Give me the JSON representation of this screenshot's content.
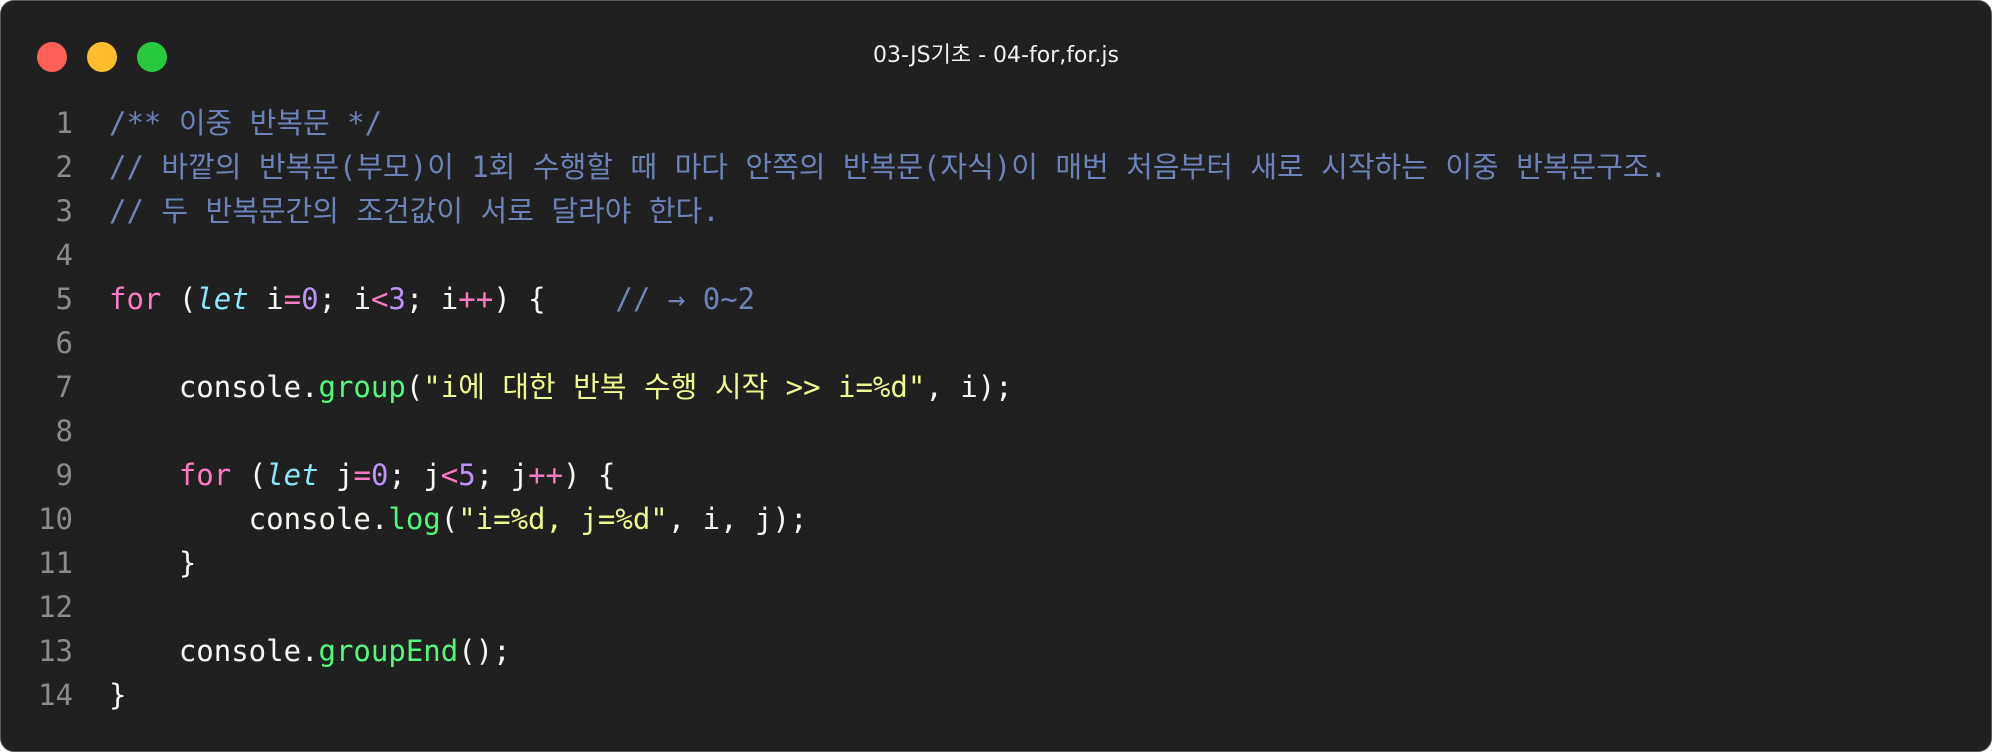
{
  "window": {
    "title": "03-JS기초 - 04-for,for.js"
  },
  "colors": {
    "background": "#202020",
    "close": "#ff5f56",
    "minimize": "#ffbd2e",
    "maximize": "#27c93f",
    "comment": "#6c83b9",
    "keyword": "#ff79c6",
    "let": "#8be9fd",
    "number": "#bd93f9",
    "function": "#50fa7b",
    "string": "#f1fa8c",
    "line_number": "#8b8b8b"
  },
  "code": {
    "lines": [
      {
        "number": "1",
        "tokens": [
          {
            "type": "comment",
            "text": "/** 이중 반복문 */"
          }
        ]
      },
      {
        "number": "2",
        "tokens": [
          {
            "type": "comment",
            "text": "// 바깥의 반복문(부모)이 1회 수행할 때 마다 안쪽의 반복문(자식)이 매번 처음부터 새로 시작하는 이중 반복문구조."
          }
        ]
      },
      {
        "number": "3",
        "tokens": [
          {
            "type": "comment",
            "text": "// 두 반복문간의 조건값이 서로 달라야 한다."
          }
        ]
      },
      {
        "number": "4",
        "tokens": []
      },
      {
        "number": "5",
        "tokens": [
          {
            "type": "keyword",
            "text": "for"
          },
          {
            "type": "plain",
            "text": " ("
          },
          {
            "type": "let",
            "text": "let"
          },
          {
            "type": "plain",
            "text": " i"
          },
          {
            "type": "op",
            "text": "="
          },
          {
            "type": "number",
            "text": "0"
          },
          {
            "type": "plain",
            "text": "; i"
          },
          {
            "type": "op",
            "text": "<"
          },
          {
            "type": "number",
            "text": "3"
          },
          {
            "type": "plain",
            "text": "; i"
          },
          {
            "type": "op",
            "text": "++"
          },
          {
            "type": "plain",
            "text": ") {    "
          },
          {
            "type": "comment",
            "text": "// → 0~2"
          }
        ]
      },
      {
        "number": "6",
        "tokens": []
      },
      {
        "number": "7",
        "tokens": [
          {
            "type": "plain",
            "text": "    console."
          },
          {
            "type": "func",
            "text": "group"
          },
          {
            "type": "plain",
            "text": "("
          },
          {
            "type": "string",
            "text": "\"i에 대한 반복 수행 시작 >> i=%d\""
          },
          {
            "type": "plain",
            "text": ", i);"
          }
        ]
      },
      {
        "number": "8",
        "tokens": []
      },
      {
        "number": "9",
        "tokens": [
          {
            "type": "plain",
            "text": "    "
          },
          {
            "type": "keyword",
            "text": "for"
          },
          {
            "type": "plain",
            "text": " ("
          },
          {
            "type": "let",
            "text": "let"
          },
          {
            "type": "plain",
            "text": " j"
          },
          {
            "type": "op",
            "text": "="
          },
          {
            "type": "number",
            "text": "0"
          },
          {
            "type": "plain",
            "text": "; j"
          },
          {
            "type": "op",
            "text": "<"
          },
          {
            "type": "number",
            "text": "5"
          },
          {
            "type": "plain",
            "text": "; j"
          },
          {
            "type": "op",
            "text": "++"
          },
          {
            "type": "plain",
            "text": ") {"
          }
        ]
      },
      {
        "number": "10",
        "tokens": [
          {
            "type": "plain",
            "text": "        console."
          },
          {
            "type": "func",
            "text": "log"
          },
          {
            "type": "plain",
            "text": "("
          },
          {
            "type": "string",
            "text": "\"i=%d, j=%d\""
          },
          {
            "type": "plain",
            "text": ", i, j);"
          }
        ]
      },
      {
        "number": "11",
        "tokens": [
          {
            "type": "plain",
            "text": "    }"
          }
        ]
      },
      {
        "number": "12",
        "tokens": []
      },
      {
        "number": "13",
        "tokens": [
          {
            "type": "plain",
            "text": "    console."
          },
          {
            "type": "func",
            "text": "groupEnd"
          },
          {
            "type": "plain",
            "text": "();"
          }
        ]
      },
      {
        "number": "14",
        "tokens": [
          {
            "type": "plain",
            "text": "}"
          }
        ]
      }
    ]
  }
}
